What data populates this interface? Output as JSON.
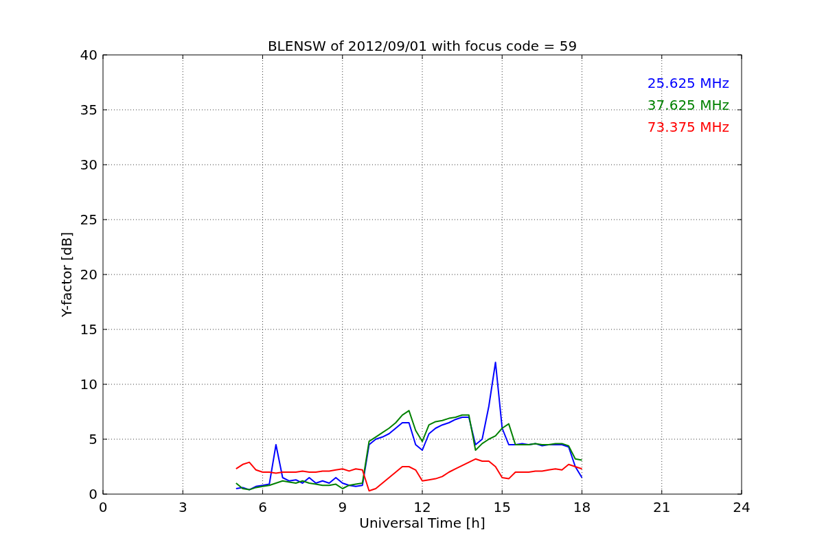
{
  "figure": {
    "chart_data": {
      "type": "line",
      "title": "BLENSW of 2012/09/01 with focus code = 59",
      "xlabel": "Universal Time [h]",
      "ylabel": "Y-factor [dB]",
      "x": [
        5,
        5.25,
        5.5,
        5.75,
        6,
        6.25,
        6.5,
        6.75,
        7,
        7.25,
        7.5,
        7.75,
        8,
        8.25,
        8.5,
        8.75,
        9,
        9.25,
        9.5,
        9.75,
        10,
        10.25,
        10.5,
        10.75,
        11,
        11.25,
        11.5,
        11.75,
        12,
        12.25,
        12.5,
        12.75,
        13,
        13.25,
        13.5,
        13.75,
        14,
        14.25,
        14.5,
        14.75,
        15,
        15.25,
        15.5,
        15.75,
        16,
        16.25,
        16.5,
        16.75,
        17,
        17.25,
        17.5,
        17.75,
        18
      ],
      "series": [
        {
          "name": "25.625 MHz",
          "color": "#0000ff",
          "values": [
            0.5,
            0.6,
            0.4,
            0.7,
            0.8,
            0.9,
            4.5,
            1.5,
            1.2,
            1.3,
            1.0,
            1.5,
            1.0,
            1.2,
            1.0,
            1.5,
            1.0,
            0.8,
            0.7,
            0.8,
            4.5,
            5.0,
            5.2,
            5.5,
            6.0,
            6.5,
            6.5,
            4.5,
            4.0,
            5.5,
            6.0,
            6.3,
            6.5,
            6.8,
            7.0,
            7.0,
            4.5,
            5.0,
            8.0,
            12.0,
            6.0,
            4.5,
            4.5,
            4.6,
            4.5,
            4.6,
            4.4,
            4.5,
            4.5,
            4.5,
            4.3,
            2.5,
            1.5
          ]
        },
        {
          "name": "37.625 MHz",
          "color": "#008000",
          "values": [
            1.0,
            0.5,
            0.4,
            0.6,
            0.7,
            0.8,
            1.0,
            1.2,
            1.1,
            1.0,
            1.2,
            1.0,
            0.9,
            0.8,
            0.8,
            0.9,
            0.5,
            0.8,
            0.9,
            1.0,
            4.8,
            5.2,
            5.6,
            6.0,
            6.5,
            7.2,
            7.6,
            5.8,
            4.8,
            6.3,
            6.6,
            6.7,
            6.9,
            7.0,
            7.2,
            7.2,
            4.0,
            4.6,
            5.0,
            5.3,
            6.0,
            6.4,
            4.5,
            4.5,
            4.5,
            4.6,
            4.5,
            4.5,
            4.6,
            4.6,
            4.4,
            3.2,
            3.1
          ]
        },
        {
          "name": "73.375 MHz",
          "color": "#ff0000",
          "values": [
            2.3,
            2.7,
            2.9,
            2.2,
            2.0,
            2.0,
            1.9,
            2.0,
            2.0,
            2.0,
            2.1,
            2.0,
            2.0,
            2.1,
            2.1,
            2.2,
            2.3,
            2.1,
            2.3,
            2.2,
            0.3,
            0.5,
            1.0,
            1.5,
            2.0,
            2.5,
            2.5,
            2.2,
            1.2,
            1.3,
            1.4,
            1.6,
            2.0,
            2.3,
            2.6,
            2.9,
            3.2,
            3.0,
            3.0,
            2.5,
            1.5,
            1.4,
            2.0,
            2.0,
            2.0,
            2.1,
            2.1,
            2.2,
            2.3,
            2.2,
            2.7,
            2.5,
            2.3
          ]
        }
      ],
      "grid": true,
      "xlim": [
        0,
        24
      ],
      "ylim": [
        0,
        40
      ],
      "xticks": [
        0,
        3,
        6,
        9,
        12,
        15,
        18,
        21,
        24
      ],
      "yticks": [
        0,
        5,
        10,
        15,
        20,
        25,
        30,
        35,
        40
      ]
    }
  }
}
